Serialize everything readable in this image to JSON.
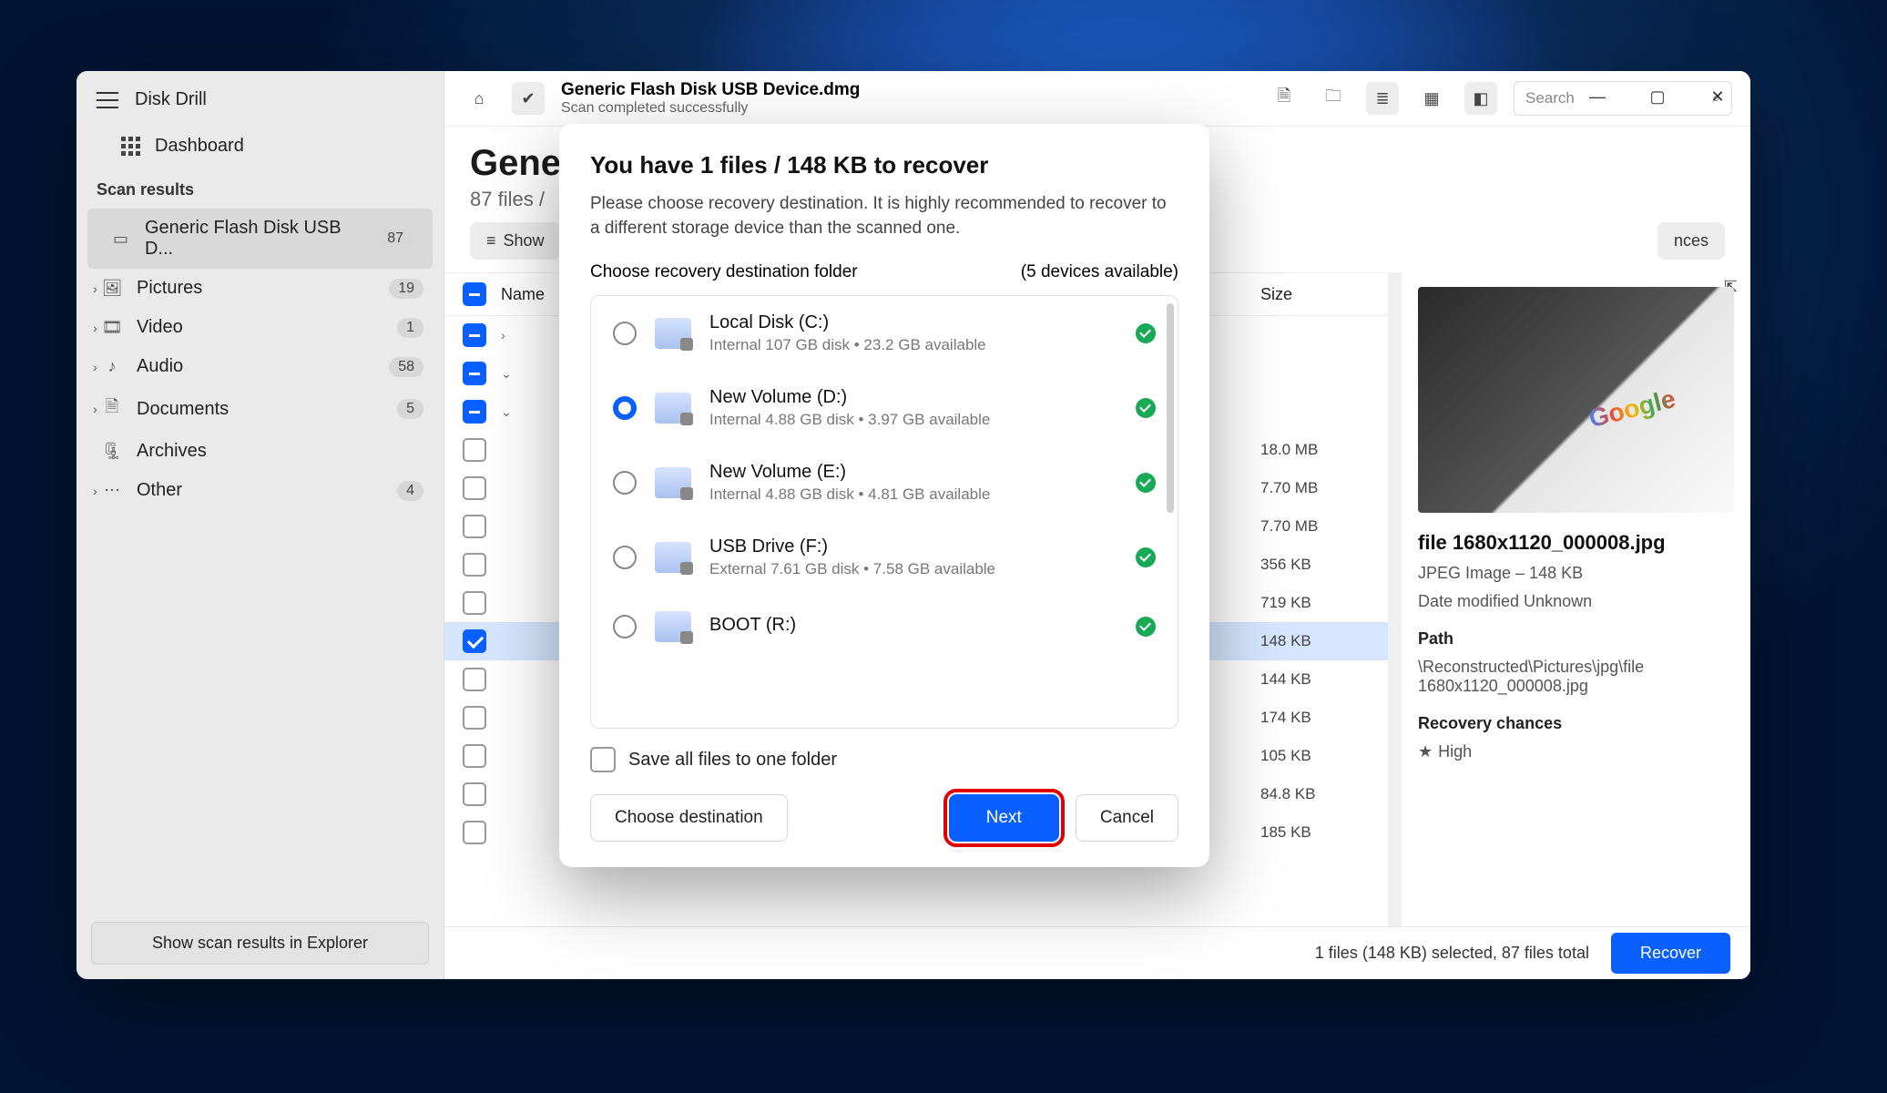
{
  "app": {
    "title": "Disk Drill"
  },
  "sidebar": {
    "dashboard": "Dashboard",
    "scan_header": "Scan results",
    "device": {
      "label": "Generic Flash Disk USB D...",
      "count": "87"
    },
    "items": [
      {
        "label": "Pictures",
        "count": "19"
      },
      {
        "label": "Video",
        "count": "1"
      },
      {
        "label": "Audio",
        "count": "58"
      },
      {
        "label": "Documents",
        "count": "5"
      },
      {
        "label": "Archives",
        "count": ""
      },
      {
        "label": "Other",
        "count": "4"
      }
    ],
    "footer_button": "Show scan results in Explorer"
  },
  "topbar": {
    "title": "Generic Flash Disk USB Device.dmg",
    "subtitle": "Scan completed successfully",
    "search_placeholder": "Search"
  },
  "page": {
    "title_visible": "Gener",
    "subtitle_visible": "87 files /",
    "filter_show": "Show",
    "filter_chances": "nces"
  },
  "columns": {
    "name": "Name",
    "size": "Size"
  },
  "rows": [
    {
      "cb": "mix",
      "arrow": "›",
      "size": ""
    },
    {
      "cb": "mix",
      "arrow": "⌄",
      "size": ""
    },
    {
      "cb": "mix",
      "arrow": "⌄",
      "size": ""
    },
    {
      "cb": "off",
      "arrow": "",
      "size": "18.0 MB"
    },
    {
      "cb": "off",
      "arrow": "",
      "size": "7.70 MB"
    },
    {
      "cb": "off",
      "arrow": "",
      "size": "7.70 MB"
    },
    {
      "cb": "off",
      "arrow": "",
      "size": "356 KB"
    },
    {
      "cb": "off",
      "arrow": "",
      "size": "719 KB"
    },
    {
      "cb": "on",
      "arrow": "",
      "size": "148 KB",
      "selected": true
    },
    {
      "cb": "off",
      "arrow": "",
      "size": "144 KB"
    },
    {
      "cb": "off",
      "arrow": "",
      "size": "174 KB"
    },
    {
      "cb": "off",
      "arrow": "",
      "size": "105 KB"
    },
    {
      "cb": "off",
      "arrow": "",
      "size": "84.8 KB"
    },
    {
      "cb": "off",
      "arrow": "",
      "size": "185 KB"
    }
  ],
  "preview": {
    "filename": "file 1680x1120_000008.jpg",
    "type_line": "JPEG Image – 148 KB",
    "modified_line": "Date modified Unknown",
    "path_label": "Path",
    "path_value": "\\Reconstructed\\Pictures\\jpg\\file 1680x1120_000008.jpg",
    "chances_label": "Recovery chances",
    "chances_value": "High"
  },
  "bottom": {
    "status": "1 files (148 KB) selected, 87 files total",
    "recover": "Recover"
  },
  "modal": {
    "title": "You have 1 files / 148 KB to recover",
    "subtitle": "Please choose recovery destination. It is highly recommended to recover to a different storage device than the scanned one.",
    "choose_label": "Choose recovery destination folder",
    "devices_available": "(5 devices available)",
    "destinations": [
      {
        "name": "Local Disk (C:)",
        "detail": "Internal 107 GB disk • 23.2 GB available",
        "selected": false
      },
      {
        "name": "New Volume (D:)",
        "detail": "Internal 4.88 GB disk • 3.97 GB available",
        "selected": true
      },
      {
        "name": "New Volume (E:)",
        "detail": "Internal 4.88 GB disk • 4.81 GB available",
        "selected": false
      },
      {
        "name": "USB Drive (F:)",
        "detail": "External 7.61 GB disk • 7.58 GB available",
        "selected": false
      },
      {
        "name": "BOOT (R:)",
        "detail": "",
        "selected": false
      }
    ],
    "save_one": "Save all files to one folder",
    "choose_btn": "Choose destination",
    "next_btn": "Next",
    "cancel_btn": "Cancel"
  }
}
